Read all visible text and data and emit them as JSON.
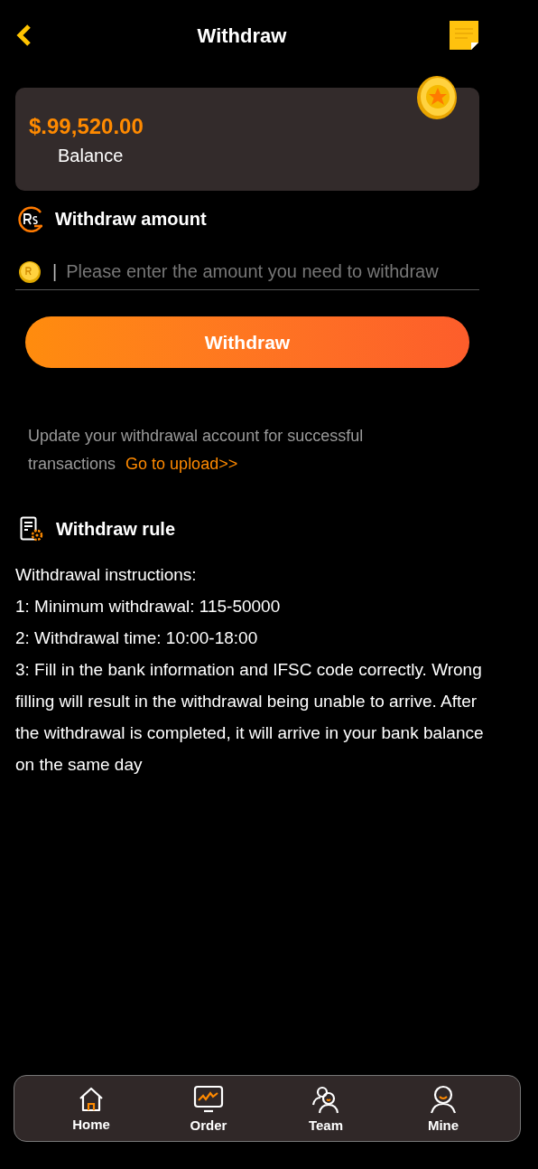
{
  "header": {
    "title": "Withdraw"
  },
  "balance": {
    "amount": "$.99,520.00",
    "label": "Balance"
  },
  "amount_section": {
    "title": "Withdraw amount",
    "placeholder": "Please enter the amount you need to withdraw",
    "separator": "|"
  },
  "withdraw_button": "Withdraw",
  "notice": {
    "text": "Update your withdrawal account for successful transactions",
    "link": "Go to upload>>"
  },
  "rules": {
    "title": "Withdraw rule",
    "lines": [
      "Withdrawal instructions:",
      "1: Minimum withdrawal: 115-50000",
      "2: Withdrawal time: 10:00-18:00",
      "3: Fill in the bank information and IFSC code correctly. Wrong filling will result in the withdrawal being unable to arrive. After the withdrawal is completed, it will arrive in your bank balance on the same day"
    ]
  },
  "nav": [
    {
      "label": "Home",
      "kind": "home"
    },
    {
      "label": "Order",
      "kind": "order"
    },
    {
      "label": "Team",
      "kind": "team"
    },
    {
      "label": "Mine",
      "kind": "mine"
    }
  ]
}
